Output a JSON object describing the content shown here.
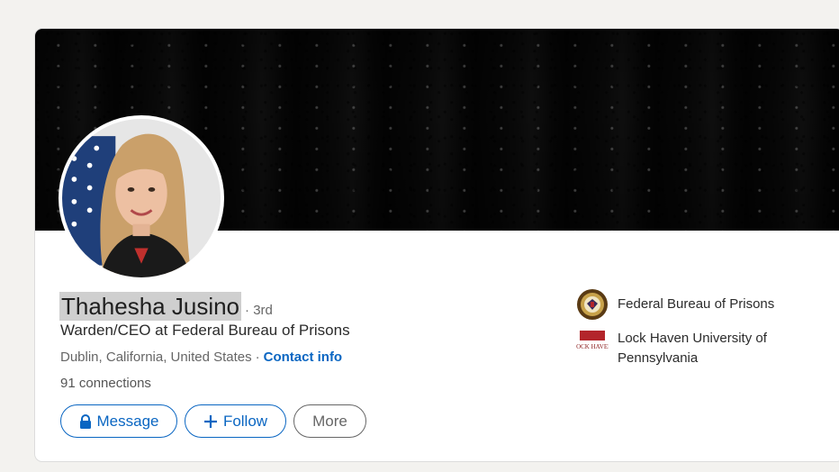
{
  "profile": {
    "name": "Thahesha Jusino",
    "degree": "· 3rd",
    "headline": "Warden/CEO at Federal Bureau of Prisons",
    "location": "Dublin, California, United States",
    "separator": "·",
    "contact_label": "Contact info",
    "connections": "91 connections"
  },
  "actions": {
    "message_label": "Message",
    "follow_label": "Follow",
    "more_label": "More"
  },
  "experience": [
    {
      "label": "Federal Bureau of Prisons",
      "icon": "doj-seal-icon"
    },
    {
      "label": "Lock Haven University of Pennsylvania",
      "icon": "lock-haven-logo-icon",
      "logo_text": "LOCK HAVEN"
    }
  ],
  "colors": {
    "link_blue": "#0a66c2",
    "page_bg": "#f3f2ef"
  }
}
